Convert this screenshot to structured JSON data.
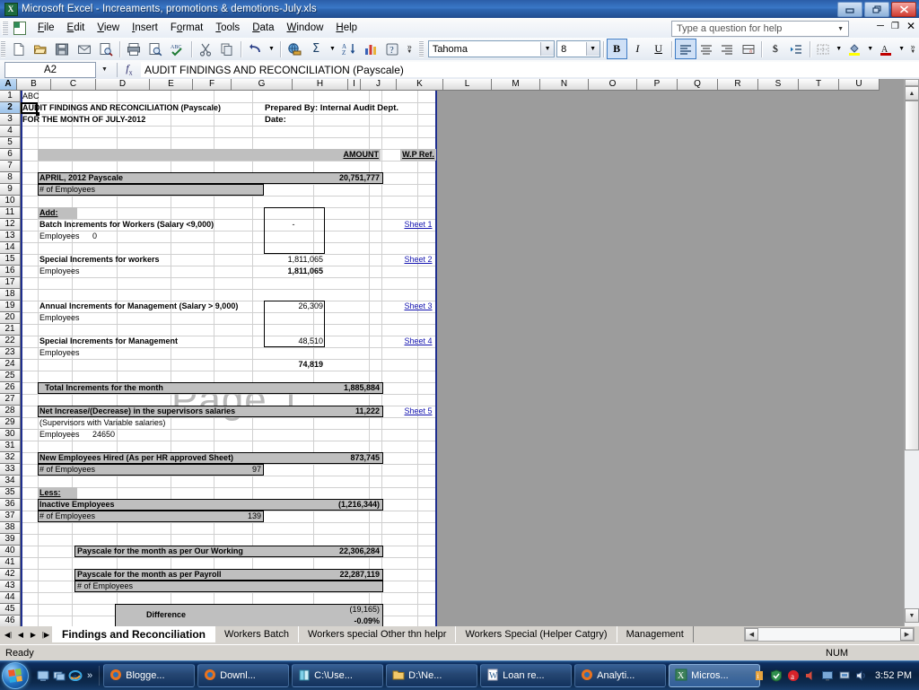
{
  "window": {
    "title": "Microsoft Excel - Increaments, promotions & demotions-July.xls",
    "app_icon": "excel-logo-icon",
    "minimize_label": "–",
    "maximize_label": "❐",
    "close_label": "✕"
  },
  "menubar": {
    "items": [
      {
        "label": "File",
        "mnemonic": "F"
      },
      {
        "label": "Edit",
        "mnemonic": "E"
      },
      {
        "label": "View",
        "mnemonic": "V"
      },
      {
        "label": "Insert",
        "mnemonic": "I"
      },
      {
        "label": "Format",
        "mnemonic": "o"
      },
      {
        "label": "Tools",
        "mnemonic": "T"
      },
      {
        "label": "Data",
        "mnemonic": "D"
      },
      {
        "label": "Window",
        "mnemonic": "W"
      },
      {
        "label": "Help",
        "mnemonic": "H"
      }
    ],
    "help_box": {
      "placeholder": "Type a question for help",
      "minimize_label": "–",
      "restore_label": "❐",
      "close_label": "✕"
    }
  },
  "toolbar": {
    "standard_icons": [
      "new-document-icon",
      "open-folder-icon",
      "save-disk-icon",
      "email-icon",
      "search-page-icon",
      "print-icon",
      "print-preview-icon",
      "spelling-check-icon",
      "cut-scissors-icon",
      "copy-icon",
      "undo-arrow-icon",
      "web-page-icon",
      "autosum-sigma-icon",
      "sort-ascending-icon",
      "chart-wizard-icon",
      "help-question-icon"
    ],
    "overflow_label": "»",
    "font_name": "Tahoma",
    "font_size": "8",
    "bold_label": "B",
    "italic_label": "I",
    "underline_label": "U",
    "align_left_icon": "align-left-icon",
    "align_center_icon": "align-center-icon",
    "align_right_icon": "align-right-icon",
    "merge_center_icon": "merge-and-center-icon",
    "currency_label": "$",
    "indent_icon": "increase-indent-icon",
    "borders_icon": "borders-icon",
    "fill_color_icon": "fill-color-icon",
    "font_color_label": "A",
    "active_buttons": [
      "bold",
      "align-left"
    ]
  },
  "formula_bar": {
    "name_box": "A2",
    "fx_label": "fx",
    "formula": "AUDIT FINDINGS AND RECONCILIATION (Payscale)"
  },
  "grid": {
    "columns": [
      "A",
      "B",
      "C",
      "D",
      "E",
      "F",
      "G",
      "H",
      "I",
      "J",
      "K",
      "L",
      "M",
      "N",
      "O",
      "P",
      "Q",
      "R",
      "S",
      "T",
      "U"
    ],
    "selected_column": "A",
    "selected_row": 2,
    "rows": [
      1,
      2,
      3,
      4,
      5,
      6,
      7,
      8,
      9,
      10,
      11,
      12,
      13,
      14,
      15,
      16,
      17,
      18,
      19,
      20,
      21,
      22,
      23,
      24,
      25,
      26,
      27,
      28,
      29,
      30,
      31,
      32,
      33,
      34,
      35,
      36,
      37,
      38,
      39,
      40,
      41,
      42,
      43,
      44,
      45,
      46
    ],
    "watermark": "Page 1",
    "cells": {
      "a1": "ABC",
      "a2": "AUDIT FINDINGS AND RECONCILIATION (Payscale)",
      "a3": "FOR THE MONTH OF JULY-2012",
      "g2": "Prepared By: Internal Audit Dept.",
      "g3": "Date:",
      "h5": "AMOUNT",
      "j5": "W.P Ref.",
      "b7": "APRIL, 2012 Payscale",
      "h7": "20,751,777",
      "b8": "# of Employees",
      "b10": "Add:",
      "b11": "Batch Increments for Workers (Salary <9,000)",
      "g11": "-",
      "j11": "Sheet 1",
      "b12": "Employees",
      "c12": "0",
      "b14": "Special Increments for workers",
      "g14": "1,811,065",
      "j14": "Sheet 2",
      "b15": "Employees",
      "g15": "1,811,065",
      "b18": "Annual Increments for Management (Salary > 9,000)",
      "g18": "26,309",
      "j18": "Sheet 3",
      "b19": "Employees",
      "b21": "Special Increments for Management",
      "g21": "48,510",
      "j21": "Sheet 4",
      "b22": "Employees",
      "g23": "74,819",
      "b25": "Total Increments for the month",
      "h25": "1,885,884",
      "b27": "Net Increase/(Decrease) in the supervisors salaries",
      "h27": "11,222",
      "j27": "Sheet 5",
      "b28": "(Supervisors with Variable salaries)",
      "b29": "Employees",
      "c29": "24650",
      "b31": "New Employees Hired (As per HR approved Sheet)",
      "h31": "873,745",
      "b32": "# of Employees",
      "f32": "97",
      "b34": "Less:",
      "b35": "Inactive Employees",
      "h35": "(1,216,344)",
      "b36": "# of Employees",
      "f36": "139",
      "d39": "Payscale for the month as per Our Working",
      "h39": "22,306,284",
      "d41": "Payscale for the month as per Payroll",
      "h41": "22,287,119",
      "d42": "# of Employees",
      "e44": "Difference",
      "h44": "(19,165)",
      "h45": "-0.09%"
    }
  },
  "sheet_tabs": {
    "nav": [
      "first-sheet-icon",
      "previous-sheet-icon",
      "next-sheet-icon",
      "last-sheet-icon"
    ],
    "tabs": [
      {
        "label": "Findings and Reconciliation",
        "active": true
      },
      {
        "label": "Workers Batch",
        "active": false
      },
      {
        "label": "Workers special Other thn helpr",
        "active": false
      },
      {
        "label": "Workers Special (Helper Catgry)",
        "active": false
      },
      {
        "label": "Management",
        "active": false
      }
    ]
  },
  "status_bar": {
    "mode": "Ready",
    "num_lock": "NUM"
  },
  "taskbar": {
    "start_label": "start-orb-icon",
    "quick_launch": [
      "show-desktop-icon",
      "switch-windows-icon",
      "internet-explorer-icon"
    ],
    "quick_launch_more": "»",
    "buttons": [
      {
        "label": "Blogge...",
        "icon": "firefox-icon",
        "active": false
      },
      {
        "label": "Downl...",
        "icon": "firefox-icon",
        "active": false
      },
      {
        "label": "C:\\Use...",
        "icon": "folder-icon",
        "active": false
      },
      {
        "label": "D:\\Ne...",
        "icon": "folder-icon",
        "active": false
      },
      {
        "label": "Loan re...",
        "icon": "word-icon",
        "active": false
      },
      {
        "label": "Analyti...",
        "icon": "firefox-icon",
        "active": false
      },
      {
        "label": "Micros...",
        "icon": "excel-icon",
        "active": true
      }
    ],
    "tray": [
      "antivirus-icon",
      "shield-icon",
      "avira-icon",
      "speaker-small-icon",
      "monitor-icon",
      "network-icon",
      "volume-icon"
    ],
    "clock": "3:52 PM"
  },
  "colors": {
    "title_bar": "#2b5ea8",
    "cell_shade": "#bfbfbf",
    "hyperlink": "#1414b0",
    "print_border": "#1f2f8f",
    "outside_print_area": "#9c9c9c"
  }
}
